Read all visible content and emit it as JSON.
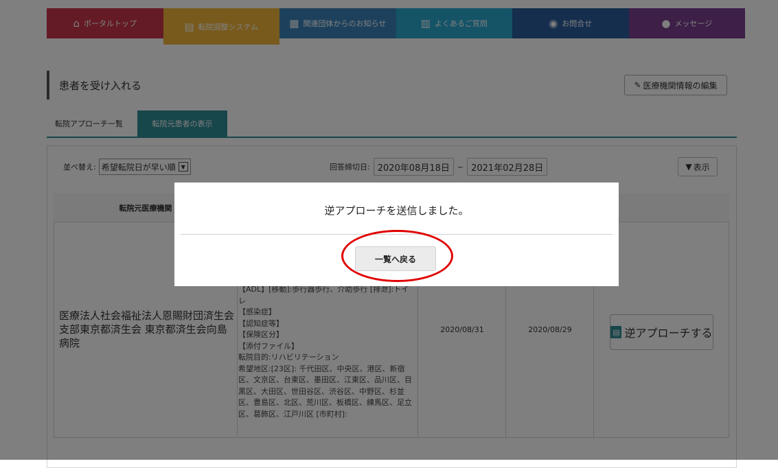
{
  "nav": {
    "tabs": [
      {
        "label": "ポータルトップ",
        "icon": "home-icon",
        "color": "#c8364b"
      },
      {
        "label": "転院調整システム",
        "icon": "chart-icon",
        "color": "#f0b43a"
      },
      {
        "label": "関連団体からのお知らせ",
        "icon": "news-icon",
        "color": "#3b83b8"
      },
      {
        "label": "よくあるご質問",
        "icon": "book-icon",
        "color": "#2aa7cf"
      },
      {
        "label": "お問合せ",
        "icon": "eye-icon",
        "color": "#2a5d9c"
      },
      {
        "label": "メッセージ",
        "icon": "chat-icon",
        "color": "#7a3f8e"
      }
    ]
  },
  "page": {
    "title": "患者を受け入れる",
    "edit_button": "医療機関情報の編集"
  },
  "subtabs": [
    "転院アプローチ一覧",
    "転院元患者の表示"
  ],
  "filter": {
    "sort_label": "並べ替え:",
    "sort_value": "希望転院日が早い順",
    "date_label": "回答締切日:",
    "date_from": "2020年08月18日",
    "date_sep": "~",
    "date_to": "2021年02月28日",
    "show_button": "表示"
  },
  "table": {
    "header_first": "転院元医療機関"
  },
  "row": {
    "hospital": "医療法人社会福祉法人恩賜財団済生会 支部東京都済生会 東京都済生会向島病院",
    "detail": "【ADL】[移動]:歩行器歩行、介助歩行 [排泄]:トイレ\n【感染症】\n【認知症等】\n【保険区分】\n【添付ファイル】\n転院目的:リハビリテーション\n希望地区:[23区]: 千代田区、中央区、港区、新宿区、文京区、台東区、墨田区、江東区、品川区、目黒区、大田区、世田谷区、渋谷区、中野区、杉並区、豊島区、北区、荒川区、板橋区、練馬区、足立区、葛飾区、江戸川区 [市町村]:",
    "date1": "2020/08/31",
    "date2": "2020/08/29",
    "action": "逆アプローチする"
  },
  "modal": {
    "message": "逆アプローチを送信しました。",
    "button": "一覧へ戻る"
  }
}
